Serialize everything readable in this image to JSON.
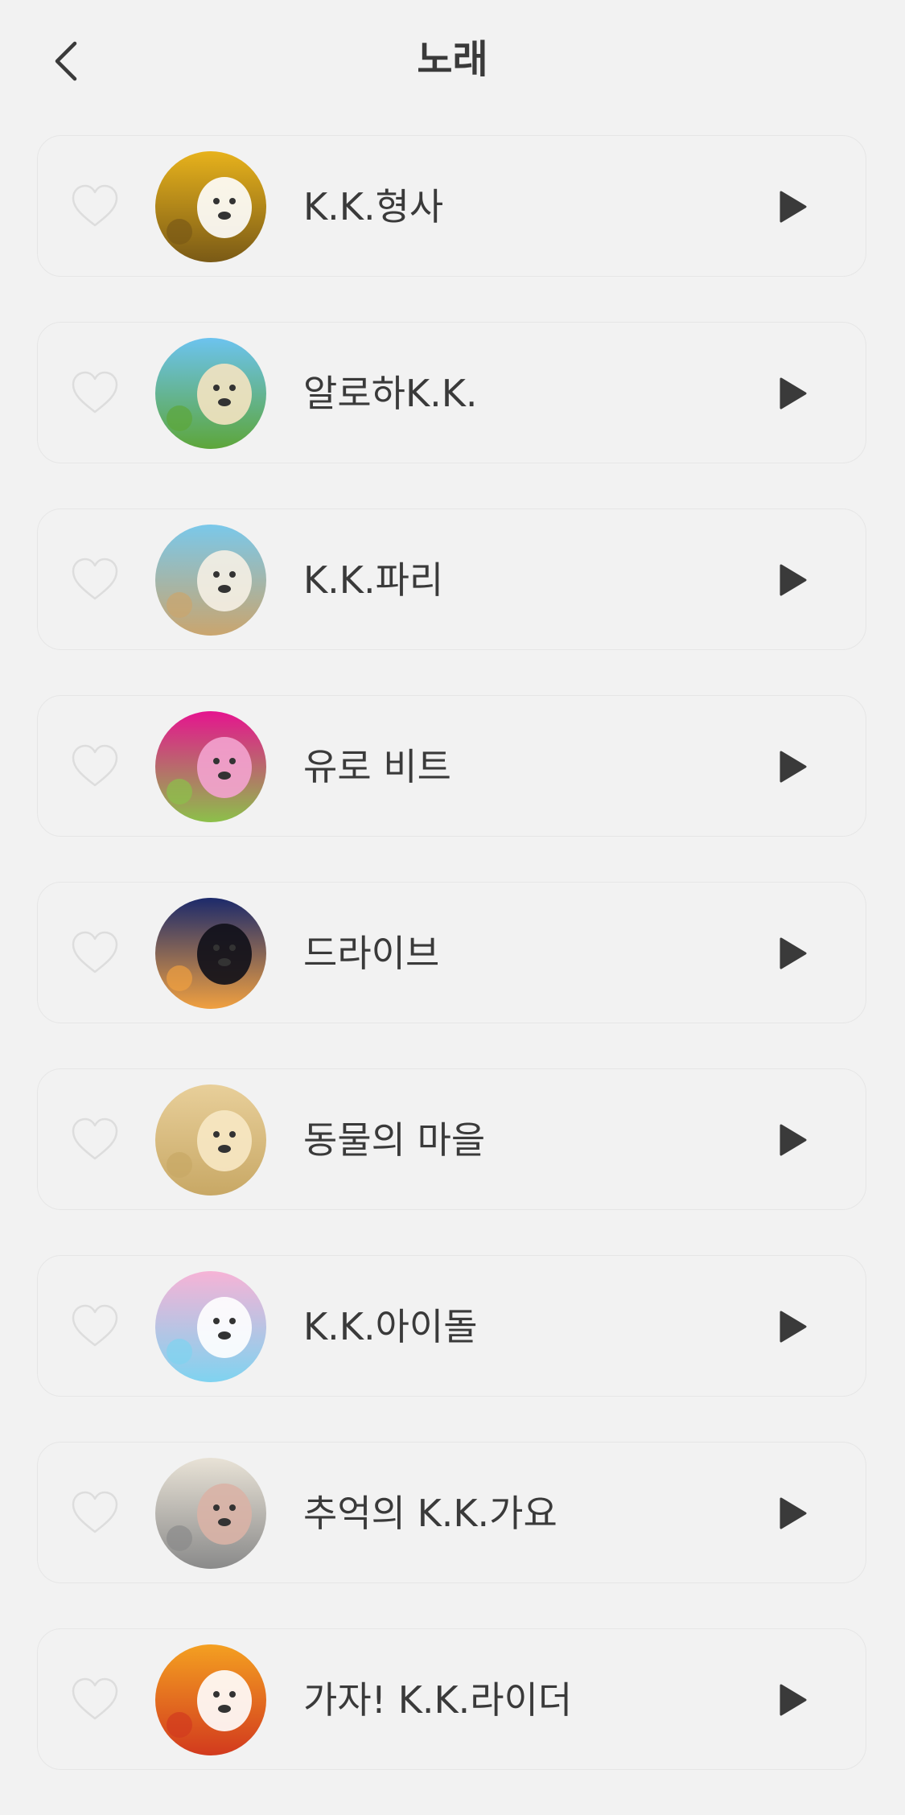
{
  "header": {
    "title": "노래",
    "back_icon": "chevron-left-icon"
  },
  "colors": {
    "background": "#f2f2f2",
    "text": "#3a3a3a",
    "card_border": "#e6e6e6",
    "heart_outline": "#dddddd",
    "play": "#3a3a3a"
  },
  "songs": [
    {
      "title": "K.K.형사",
      "icon": "album-cover",
      "colors": [
        "#e7b21c",
        "#7a5a16",
        "#ffffff"
      ]
    },
    {
      "title": "알로하K.K.",
      "icon": "album-cover",
      "colors": [
        "#6cc3ef",
        "#5da63a",
        "#f4e3c1"
      ]
    },
    {
      "title": "K.K.파리",
      "icon": "album-cover",
      "colors": [
        "#7ac8ea",
        "#caa56e",
        "#f5efe4"
      ]
    },
    {
      "title": "유로 비트",
      "icon": "album-cover",
      "colors": [
        "#e5148f",
        "#8cc04a",
        "#f3a3cf"
      ]
    },
    {
      "title": "드라이브",
      "icon": "album-cover",
      "colors": [
        "#1c2a6b",
        "#f0a040",
        "#101018"
      ]
    },
    {
      "title": "동물의 마을",
      "icon": "album-cover",
      "colors": [
        "#e8cf9a",
        "#c8a865",
        "#f7e8c4"
      ]
    },
    {
      "title": "K.K.아이돌",
      "icon": "album-cover",
      "colors": [
        "#f6b3d6",
        "#7fd3f0",
        "#ffffff"
      ]
    },
    {
      "title": "추억의 K.K.가요",
      "icon": "album-cover",
      "colors": [
        "#e8e2d6",
        "#8a8a8a",
        "#d9b3a6"
      ]
    },
    {
      "title": "가자! K.K.라이더",
      "icon": "album-cover",
      "colors": [
        "#f4a021",
        "#d23a1e",
        "#ffffff"
      ]
    }
  ]
}
